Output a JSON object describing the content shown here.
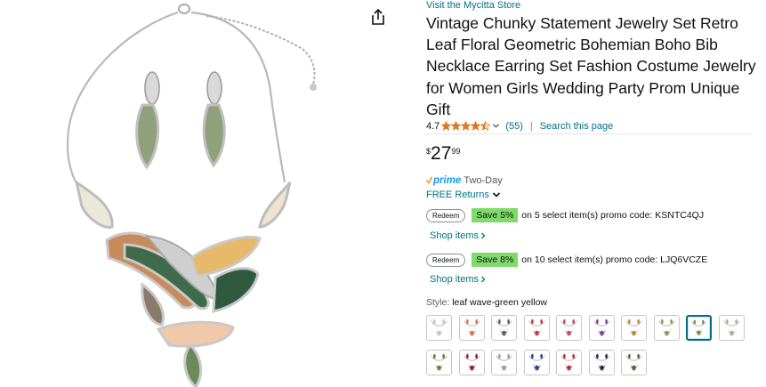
{
  "store": {
    "link_label": "Visit the Mycitta Store"
  },
  "product": {
    "title": "Vintage Chunky Statement Jewelry Set Retro Leaf Floral Geometric Bohemian Boho Bib Necklace Earring Set Fashion Costume Jewelry for Women Girls Wedding Party Prom Unique Gift"
  },
  "rating": {
    "value": "4.7",
    "stars": 4.5,
    "count_label": "(55)",
    "separator": "|",
    "search_label": "Search this page"
  },
  "price": {
    "symbol": "$",
    "whole": "27",
    "fraction": "99"
  },
  "delivery": {
    "prime_label": "prime",
    "prime_detail": "Two-Day",
    "returns_label": "FREE Returns"
  },
  "promos": [
    {
      "redeem_label": "Redeem",
      "save_label": "Save 5%",
      "text": "on 5 select item(s) promo code: KSNTC4QJ",
      "shop_label": "Shop items"
    },
    {
      "redeem_label": "Redeem",
      "save_label": "Save 8%",
      "text": "on 10 select item(s) promo code: LJQ6VCZE",
      "shop_label": "Shop items"
    }
  ],
  "style": {
    "label": "Style: ",
    "value": "leaf wave-green yellow"
  },
  "swatches": {
    "selected_index": 8,
    "row1_colors": [
      "#b9c9c9",
      "#d9704d",
      "#5b5b5b",
      "#c8334a",
      "#c24a6a",
      "#7a3f8c",
      "#b88a3a",
      "#8a9a4a",
      "#6f8f4f",
      "#9fb0a0"
    ],
    "row2_colors": [
      "#6a7d3a",
      "#8a1f2a",
      "#8aa0b0",
      "#2a3f8a",
      "#c02a2a",
      "#1f2a4a",
      "#4a6a3a"
    ]
  },
  "colors": {
    "link": "#007185",
    "save_badge": "#7fda69",
    "prime_blue": "#1399ff",
    "star": "#de7921"
  },
  "icons": {
    "share": "share-icon",
    "star": "star-icon",
    "chevron": "chevron-down-icon",
    "prime_check": "prime-check-icon"
  }
}
